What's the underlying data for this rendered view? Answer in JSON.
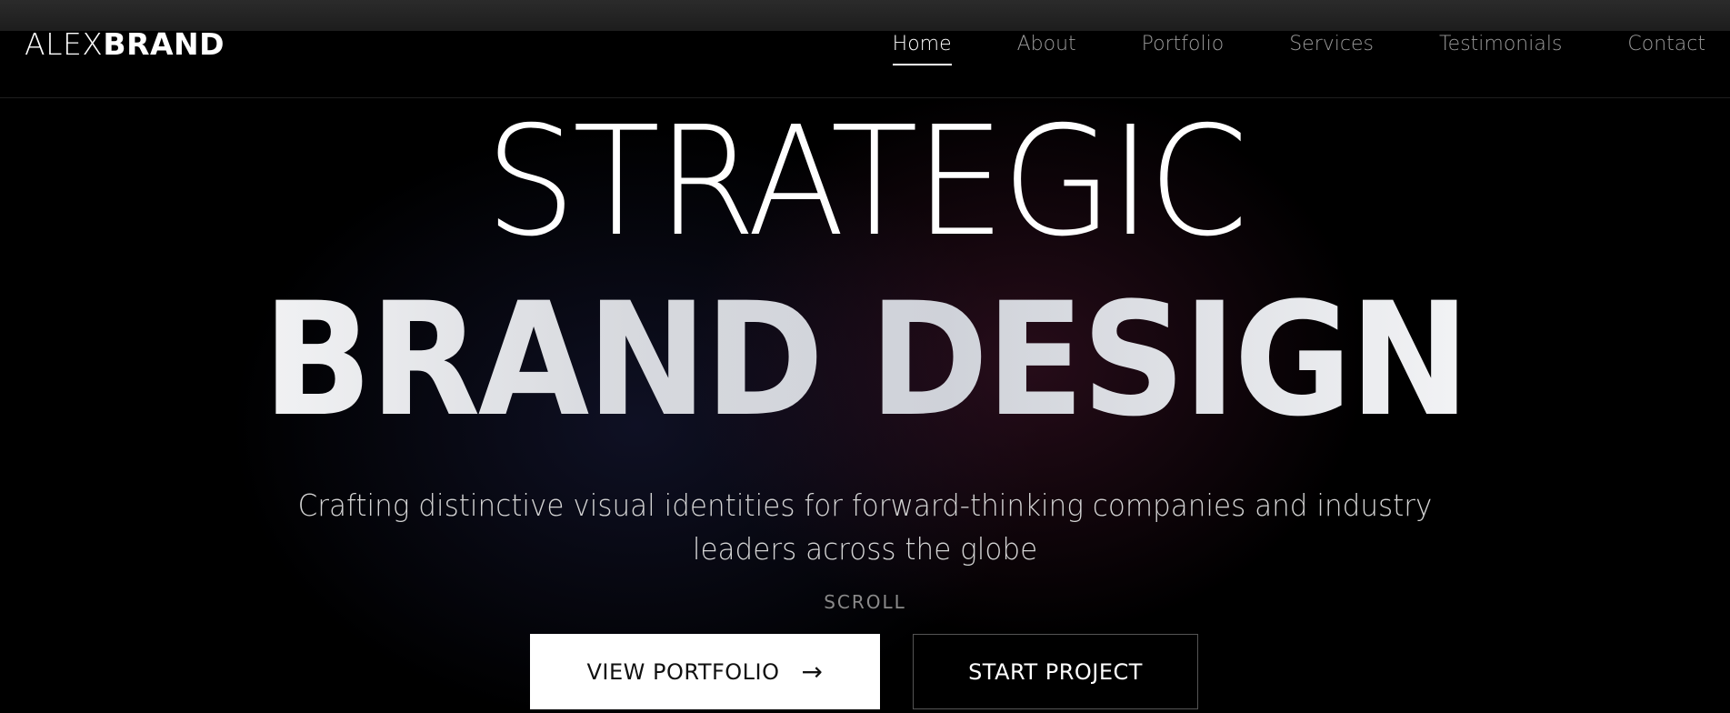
{
  "brand": {
    "logo_light": "ALEX",
    "logo_bold": "BRAND"
  },
  "nav": {
    "items": [
      {
        "label": "Home",
        "active": true
      },
      {
        "label": "About",
        "active": false
      },
      {
        "label": "Portfolio",
        "active": false
      },
      {
        "label": "Services",
        "active": false
      },
      {
        "label": "Testimonials",
        "active": false
      },
      {
        "label": "Contact",
        "active": false
      }
    ]
  },
  "hero": {
    "headline_line1": "STRATEGIC",
    "headline_line2": "BRAND DESIGN",
    "subtitle": "Crafting distinctive visual identities for forward-thinking companies and industry leaders across the globe",
    "scroll_label": "SCROLL"
  },
  "actions": {
    "primary_label": "VIEW PORTFOLIO",
    "primary_icon": "arrow-right-icon",
    "secondary_label": "START PROJECT"
  },
  "colors": {
    "background": "#000000",
    "text": "#ffffff",
    "nav_inactive": "#9a9a9a",
    "primary_button_bg": "#ffffff",
    "secondary_button_border": "#555555"
  }
}
